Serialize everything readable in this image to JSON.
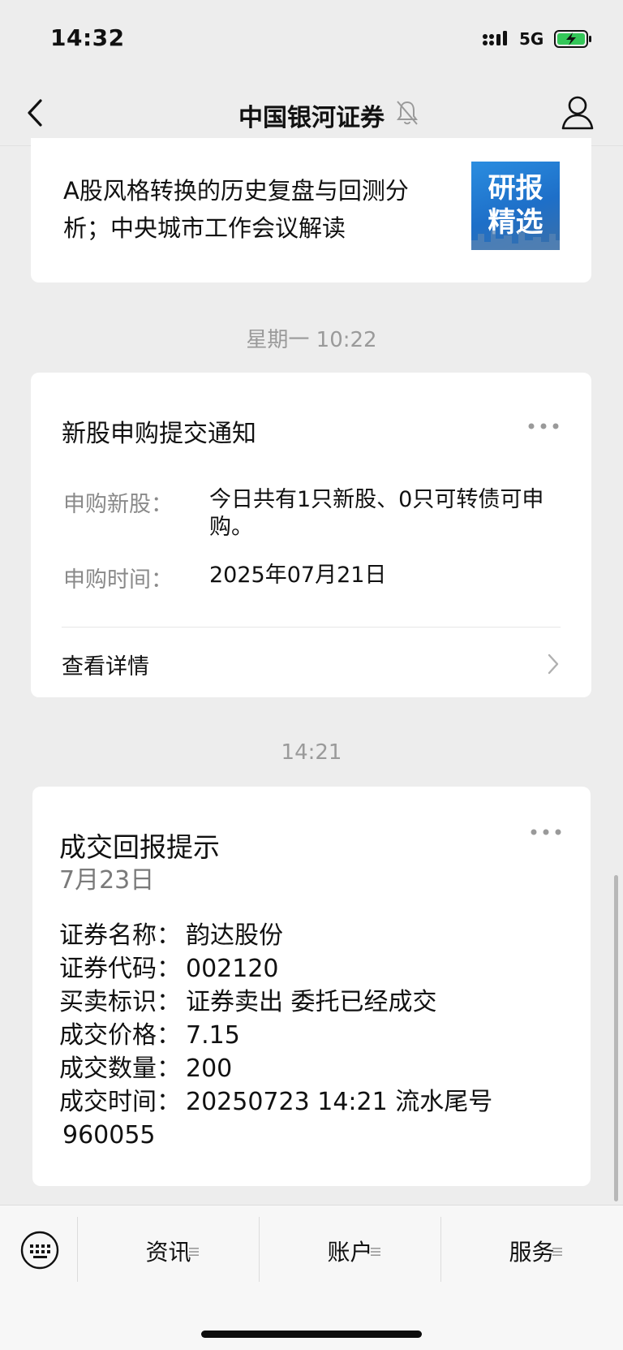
{
  "status": {
    "time": "14:32",
    "network": "5G"
  },
  "header": {
    "title": "中国银河证券"
  },
  "report_card": {
    "title": "A股风格转换的历史复盘与回测分析；中央城市工作会议解读",
    "thumb_text_line1": "研报",
    "thumb_text_line2": "精选"
  },
  "separator_1": "星期一 10:22",
  "ipo_card": {
    "title": "新股申购提交通知",
    "rows": [
      {
        "label": "申购新股：",
        "value": "今日共有1只新股、0只可转债可申购。"
      },
      {
        "label": "申购时间：",
        "value": "2025年07月21日"
      }
    ],
    "detail_label": "查看详情"
  },
  "separator_2": "14:21",
  "trade_card": {
    "title": "成交回报提示",
    "date": "7月23日",
    "rows": [
      {
        "label": "证券名称：",
        "value": "韵达股份"
      },
      {
        "label": "证券代码：",
        "value": "002120"
      },
      {
        "label": "买卖标识：",
        "value": "证券卖出  委托已经成交"
      },
      {
        "label": "成交价格：",
        "value": "7.15"
      },
      {
        "label": "成交数量：",
        "value": "200"
      },
      {
        "label": "成交时间：",
        "value": "20250723 14:21 流水尾号"
      }
    ],
    "tail": "960055"
  },
  "bottom_menu": {
    "items": [
      {
        "label": "资讯",
        "icon": "menu-lines-icon"
      },
      {
        "label": "账户",
        "icon": "menu-lines-icon"
      },
      {
        "label": "服务",
        "icon": "menu-lines-icon"
      }
    ]
  },
  "colors": {
    "thumb_blue": "#1e6fc8",
    "battery_green": "#34c759"
  }
}
